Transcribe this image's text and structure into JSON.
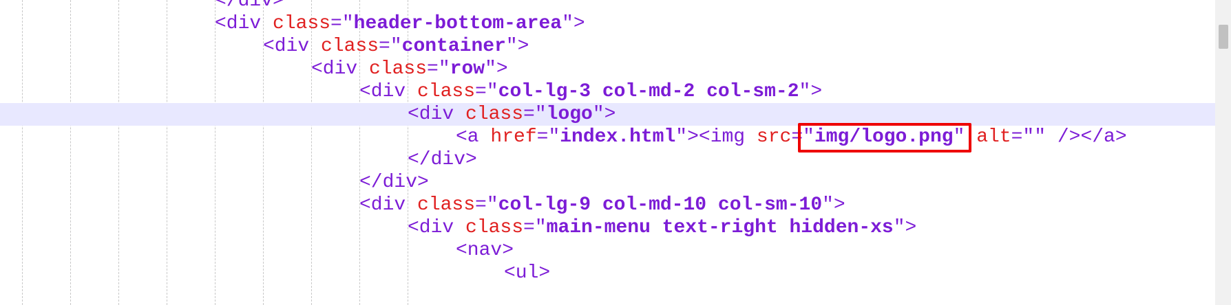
{
  "editor": {
    "lines": [
      {
        "indent_col": 3,
        "partial_top": true,
        "tokens": [
          {
            "t": "tag",
            "v": "</div>"
          }
        ]
      },
      {
        "indent_col": 3,
        "tokens": [
          {
            "t": "tag",
            "v": "<div "
          },
          {
            "t": "attr",
            "v": "class"
          },
          {
            "t": "eq",
            "v": "=\""
          },
          {
            "t": "val",
            "v": "header-bottom-area"
          },
          {
            "t": "eq",
            "v": "\">"
          }
        ]
      },
      {
        "indent_col": 4,
        "tokens": [
          {
            "t": "tag",
            "v": "<div "
          },
          {
            "t": "attr",
            "v": "class"
          },
          {
            "t": "eq",
            "v": "=\""
          },
          {
            "t": "val",
            "v": "container"
          },
          {
            "t": "eq",
            "v": "\">"
          }
        ]
      },
      {
        "indent_col": 5,
        "tokens": [
          {
            "t": "tag",
            "v": "<div "
          },
          {
            "t": "attr",
            "v": "class"
          },
          {
            "t": "eq",
            "v": "=\""
          },
          {
            "t": "val",
            "v": "row"
          },
          {
            "t": "eq",
            "v": "\">"
          }
        ]
      },
      {
        "indent_col": 6,
        "tokens": [
          {
            "t": "tag",
            "v": "<div "
          },
          {
            "t": "attr",
            "v": "class"
          },
          {
            "t": "eq",
            "v": "=\""
          },
          {
            "t": "val",
            "v": "col-lg-3 col-md-2 col-sm-2"
          },
          {
            "t": "eq",
            "v": "\">"
          }
        ]
      },
      {
        "indent_col": 7,
        "highlighted": true,
        "tokens": [
          {
            "t": "tag",
            "v": "<div "
          },
          {
            "t": "attr",
            "v": "class"
          },
          {
            "t": "eq",
            "v": "=\""
          },
          {
            "t": "val",
            "v": "logo"
          },
          {
            "t": "eq",
            "v": "\">"
          }
        ]
      },
      {
        "indent_col": 8,
        "tokens": [
          {
            "t": "tag",
            "v": "<a "
          },
          {
            "t": "attr",
            "v": "href"
          },
          {
            "t": "eq",
            "v": "=\""
          },
          {
            "t": "val",
            "v": "index.html"
          },
          {
            "t": "eq",
            "v": "\">"
          },
          {
            "t": "tag",
            "v": "<img "
          },
          {
            "t": "attr",
            "v": "src"
          },
          {
            "t": "eq",
            "v": "=\""
          },
          {
            "t": "val",
            "v": "img/logo.png"
          },
          {
            "t": "eq",
            "v": "\" "
          },
          {
            "t": "attr",
            "v": "alt"
          },
          {
            "t": "eq",
            "v": "=\"\" />"
          },
          {
            "t": "tag",
            "v": "</a>"
          }
        ]
      },
      {
        "indent_col": 7,
        "tokens": [
          {
            "t": "tag",
            "v": "</div>"
          }
        ]
      },
      {
        "indent_col": 6,
        "tokens": [
          {
            "t": "tag",
            "v": "</div>"
          }
        ]
      },
      {
        "indent_col": 6,
        "tokens": [
          {
            "t": "tag",
            "v": "<div "
          },
          {
            "t": "attr",
            "v": "class"
          },
          {
            "t": "eq",
            "v": "=\""
          },
          {
            "t": "val",
            "v": "col-lg-9 col-md-10 col-sm-10"
          },
          {
            "t": "eq",
            "v": "\">"
          }
        ]
      },
      {
        "indent_col": 7,
        "tokens": [
          {
            "t": "tag",
            "v": "<div "
          },
          {
            "t": "attr",
            "v": "class"
          },
          {
            "t": "eq",
            "v": "=\""
          },
          {
            "t": "val",
            "v": "main-menu text-right hidden-xs"
          },
          {
            "t": "eq",
            "v": "\">"
          }
        ]
      },
      {
        "indent_col": 8,
        "tokens": [
          {
            "t": "tag",
            "v": "<nav>"
          }
        ]
      },
      {
        "indent_col": 9,
        "partial_bottom": true,
        "tokens": [
          {
            "t": "tag",
            "v": "<ul>"
          }
        ]
      }
    ],
    "highlight_box_target": "img/logo.png",
    "colors": {
      "tag": "#7c1cd6",
      "attribute": "#e02020",
      "value": "#7c1cd6",
      "line_highlight": "#e8e8ff",
      "annotation_box": "#ee0000"
    }
  },
  "scrollbar": {
    "thumb_position": 0.05
  }
}
